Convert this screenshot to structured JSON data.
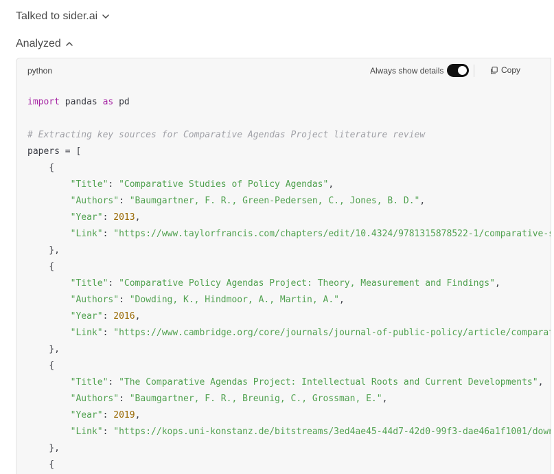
{
  "header": {
    "talked_label": "Talked to sider.ai",
    "analyzed_label": "Analyzed"
  },
  "panel": {
    "language": "python",
    "details_label": "Always show details",
    "details_on": true,
    "copy_label": "Copy"
  },
  "code": {
    "lines": [
      [
        {
          "t": "kw",
          "v": "import"
        },
        {
          "t": "pl",
          "v": " pandas "
        },
        {
          "t": "kw",
          "v": "as"
        },
        {
          "t": "pl",
          "v": " pd"
        }
      ],
      [],
      [
        {
          "t": "cm",
          "v": "# Extracting key sources for Comparative Agendas Project literature review"
        }
      ],
      [
        {
          "t": "pl",
          "v": "papers = ["
        }
      ],
      [
        {
          "t": "pl",
          "v": "    {"
        }
      ],
      [
        {
          "t": "pl",
          "v": "        "
        },
        {
          "t": "str",
          "v": "\"Title\""
        },
        {
          "t": "pl",
          "v": ": "
        },
        {
          "t": "str",
          "v": "\"Comparative Studies of Policy Agendas\""
        },
        {
          "t": "pl",
          "v": ","
        }
      ],
      [
        {
          "t": "pl",
          "v": "        "
        },
        {
          "t": "str",
          "v": "\"Authors\""
        },
        {
          "t": "pl",
          "v": ": "
        },
        {
          "t": "str",
          "v": "\"Baumgartner, F. R., Green-Pedersen, C., Jones, B. D.\""
        },
        {
          "t": "pl",
          "v": ","
        }
      ],
      [
        {
          "t": "pl",
          "v": "        "
        },
        {
          "t": "str",
          "v": "\"Year\""
        },
        {
          "t": "pl",
          "v": ": "
        },
        {
          "t": "num",
          "v": "2013"
        },
        {
          "t": "pl",
          "v": ","
        }
      ],
      [
        {
          "t": "pl",
          "v": "        "
        },
        {
          "t": "str",
          "v": "\"Link\""
        },
        {
          "t": "pl",
          "v": ": "
        },
        {
          "t": "str",
          "v": "\"https://www.taylorfrancis.com/chapters/edit/10.4324/9781315878522-1/comparative-s"
        }
      ],
      [
        {
          "t": "pl",
          "v": "    },"
        }
      ],
      [
        {
          "t": "pl",
          "v": "    {"
        }
      ],
      [
        {
          "t": "pl",
          "v": "        "
        },
        {
          "t": "str",
          "v": "\"Title\""
        },
        {
          "t": "pl",
          "v": ": "
        },
        {
          "t": "str",
          "v": "\"Comparative Policy Agendas Project: Theory, Measurement and Findings\""
        },
        {
          "t": "pl",
          "v": ","
        }
      ],
      [
        {
          "t": "pl",
          "v": "        "
        },
        {
          "t": "str",
          "v": "\"Authors\""
        },
        {
          "t": "pl",
          "v": ": "
        },
        {
          "t": "str",
          "v": "\"Dowding, K., Hindmoor, A., Martin, A.\""
        },
        {
          "t": "pl",
          "v": ","
        }
      ],
      [
        {
          "t": "pl",
          "v": "        "
        },
        {
          "t": "str",
          "v": "\"Year\""
        },
        {
          "t": "pl",
          "v": ": "
        },
        {
          "t": "num",
          "v": "2016"
        },
        {
          "t": "pl",
          "v": ","
        }
      ],
      [
        {
          "t": "pl",
          "v": "        "
        },
        {
          "t": "str",
          "v": "\"Link\""
        },
        {
          "t": "pl",
          "v": ": "
        },
        {
          "t": "str",
          "v": "\"https://www.cambridge.org/core/journals/journal-of-public-policy/article/comparat"
        }
      ],
      [
        {
          "t": "pl",
          "v": "    },"
        }
      ],
      [
        {
          "t": "pl",
          "v": "    {"
        }
      ],
      [
        {
          "t": "pl",
          "v": "        "
        },
        {
          "t": "str",
          "v": "\"Title\""
        },
        {
          "t": "pl",
          "v": ": "
        },
        {
          "t": "str",
          "v": "\"The Comparative Agendas Project: Intellectual Roots and Current Developments\""
        },
        {
          "t": "pl",
          "v": ","
        }
      ],
      [
        {
          "t": "pl",
          "v": "        "
        },
        {
          "t": "str",
          "v": "\"Authors\""
        },
        {
          "t": "pl",
          "v": ": "
        },
        {
          "t": "str",
          "v": "\"Baumgartner, F. R., Breunig, C., Grossman, E.\""
        },
        {
          "t": "pl",
          "v": ","
        }
      ],
      [
        {
          "t": "pl",
          "v": "        "
        },
        {
          "t": "str",
          "v": "\"Year\""
        },
        {
          "t": "pl",
          "v": ": "
        },
        {
          "t": "num",
          "v": "2019"
        },
        {
          "t": "pl",
          "v": ","
        }
      ],
      [
        {
          "t": "pl",
          "v": "        "
        },
        {
          "t": "str",
          "v": "\"Link\""
        },
        {
          "t": "pl",
          "v": ": "
        },
        {
          "t": "str",
          "v": "\"https://kops.uni-konstanz.de/bitstreams/3ed4ae45-44d7-42d0-99f3-dae46a1f1001/down"
        }
      ],
      [
        {
          "t": "pl",
          "v": "    },"
        }
      ],
      [
        {
          "t": "pl",
          "v": "    {"
        }
      ]
    ]
  },
  "icons": {
    "talked_chevron": "chevron-down-icon",
    "analyzed_chevron": "chevron-up-icon",
    "copy": "copy-icon"
  },
  "colors": {
    "keyword": "#a626a4",
    "comment": "#a0a1a7",
    "string": "#50a14f",
    "number": "#986801",
    "panel_bg": "#f7f7f7",
    "switch_on": "#111111"
  }
}
